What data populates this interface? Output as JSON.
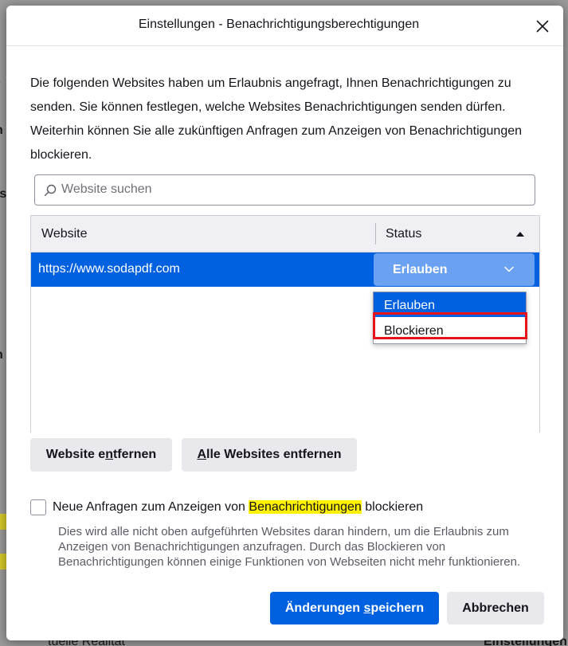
{
  "background": {
    "fragment_right_bottom": "Einstellungen",
    "fragment_left_bottom": "tuelle Realität"
  },
  "dialog": {
    "title": "Einstellungen - Benachrichtigungsberechtigungen",
    "intro": "Die folgenden Websites haben um Erlaubnis angefragt, Ihnen Benachrichtigungen zu senden. Sie können festlegen, welche Websites Benachrichtigungen senden dürfen. Weiterhin können Sie alle zukünftigen Anfragen zum Anzeigen von Benachrichtigungen blockieren.",
    "search": {
      "placeholder": "Website suchen",
      "value": ""
    },
    "table": {
      "col_website": "Website",
      "col_status": "Status",
      "rows": [
        {
          "url": "https://www.sodapdf.com",
          "status": "Erlauben"
        }
      ]
    },
    "dropdown": {
      "options": [
        "Erlauben",
        "Blockieren"
      ],
      "selected": "Erlauben"
    },
    "buttons": {
      "remove_pre": "Website e",
      "remove_access": "n",
      "remove_post": "tfernen",
      "remove_all_access": "A",
      "remove_all_post": "lle Websites entfernen",
      "save_pre": "Änderungen ",
      "save_access": "s",
      "save_post": "peichern",
      "cancel": "Abbrechen"
    },
    "block_checkbox": {
      "checked": false,
      "label_pre": "Neue Anfragen zum Anzeigen von ",
      "label_highlight": "Benachrichtigungen",
      "label_post": " blockieren",
      "help": "Dies wird alle nicht oben aufgeführten Websites daran hindern, um die Erlaubnis zum Anzeigen von Benachrichtigungen anzufragen. Durch das Blockieren von Benachrichtigungen können einige Funktionen von Webseiten nicht mehr funktionieren."
    }
  },
  "colors": {
    "accent": "#0061e0",
    "highlight": "#fff200",
    "annotation_box": "#e8141c"
  }
}
